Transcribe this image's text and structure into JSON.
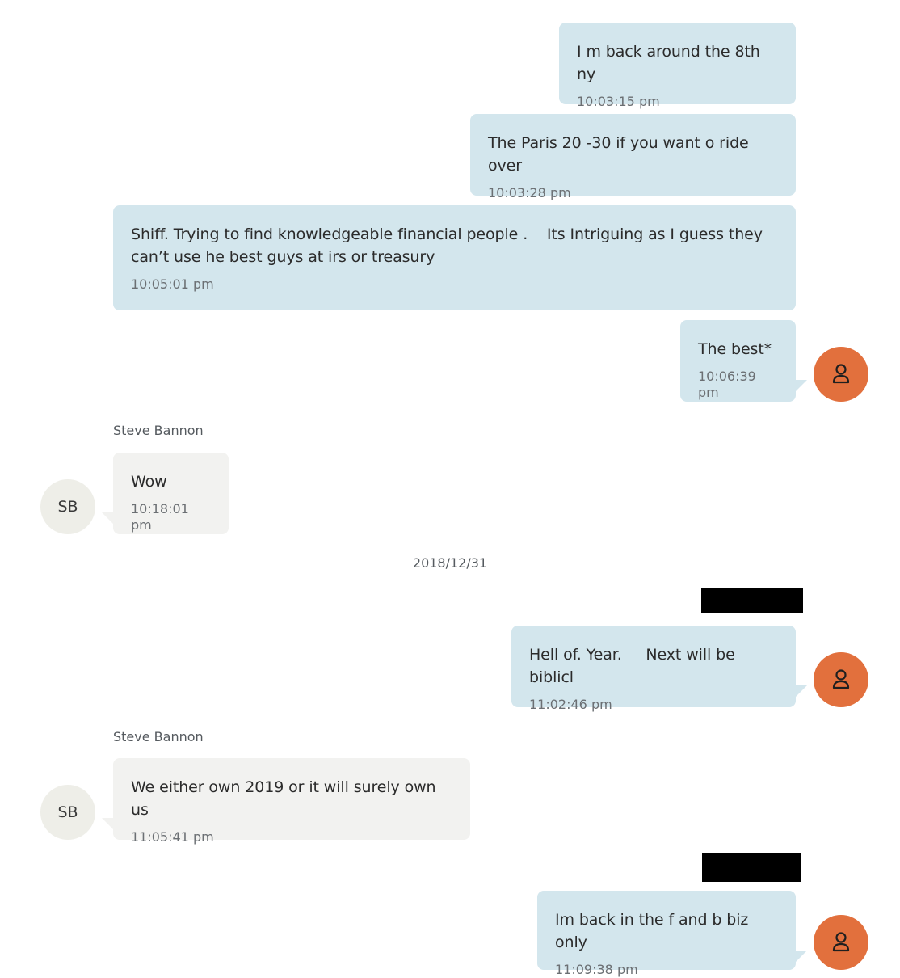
{
  "messages": [
    {
      "text": "I m back around the 8th ny",
      "time": "10:03:15 pm"
    },
    {
      "text": "The Paris 20 -30 if you want o ride over",
      "time": "10:03:28 pm"
    },
    {
      "text": "Shiff. Trying to find knowledgeable financial people .    Its Intriguing as I guess they\ncan’t use he best guys at irs or treasury",
      "time": "10:05:01 pm"
    },
    {
      "text": "The best*",
      "time": "10:06:39 pm"
    },
    {
      "sender": "Steve Bannon",
      "avatar": "SB",
      "text": "Wow",
      "time": "10:18:01 pm"
    },
    {
      "text": "Hell of. Year.     Next will be biblicl",
      "time": "11:02:46 pm"
    },
    {
      "sender": "Steve Bannon",
      "avatar": "SB",
      "text": "We either own 2019 or it will surely own us",
      "time": "11:05:41 pm"
    },
    {
      "text": "Im back in the f and b biz only",
      "time": "11:09:38 pm"
    }
  ],
  "date_separator": "2018/12/31",
  "colors": {
    "outgoing_bubble": "#d3e6ed",
    "incoming_bubble": "#f2f2f0",
    "user_avatar": "#e2703d",
    "contact_avatar": "#eeeee8",
    "redaction": "#000000"
  },
  "icons": {
    "user_avatar": "person-icon"
  }
}
